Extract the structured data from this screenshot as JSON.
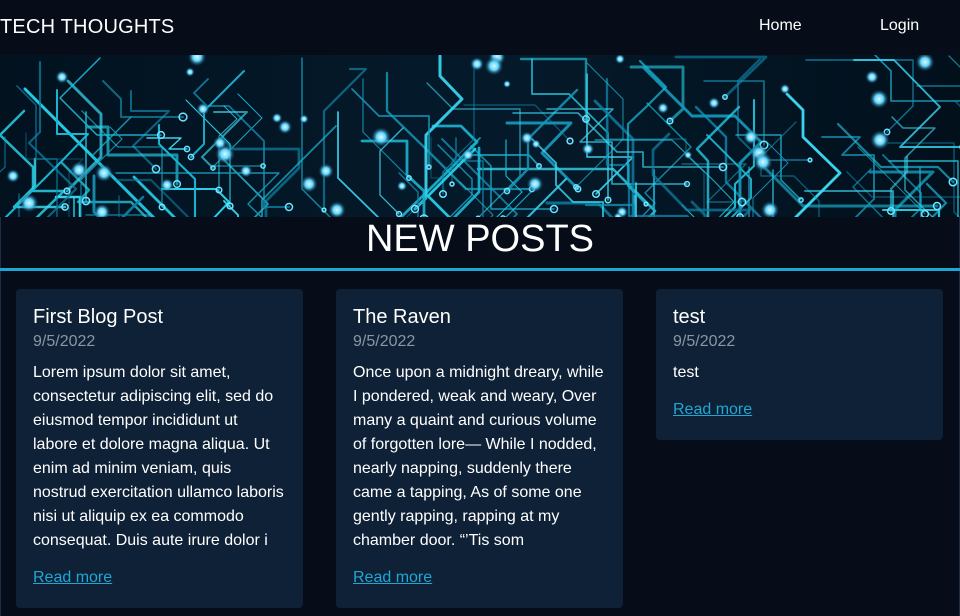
{
  "header": {
    "brand": "TECH THOUGHTS",
    "nav": [
      {
        "label": "Home"
      },
      {
        "label": "Login"
      }
    ]
  },
  "hero": {
    "image": "circuit-board-banner"
  },
  "section": {
    "title": "NEW POSTS"
  },
  "posts": [
    {
      "title": "First Blog Post",
      "date": "9/5/2022",
      "excerpt": "Lorem ipsum dolor sit amet, consectetur adipiscing elit, sed do eiusmod tempor incididunt ut labore et dolore magna aliqua. Ut enim ad minim veniam, quis nostrud exercitation ullamco laboris nisi ut aliquip ex ea commodo consequat. Duis aute irure dolor i",
      "link_label": "Read more"
    },
    {
      "title": "The Raven",
      "date": "9/5/2022",
      "excerpt": "Once upon a midnight dreary, while I pondered, weak and weary, Over many a quaint and curious volume of forgotten lore— While I nodded, nearly napping, suddenly there came a tapping, As of some one gently rapping, rapping at my chamber door. “’Tis som",
      "link_label": "Read more"
    },
    {
      "title": "test",
      "date": "9/5/2022",
      "excerpt": "test",
      "link_label": "Read more"
    }
  ],
  "colors": {
    "background": "#060d19",
    "card": "#0f2136",
    "accent": "#1fa6d4",
    "muted": "#8a97a6"
  }
}
